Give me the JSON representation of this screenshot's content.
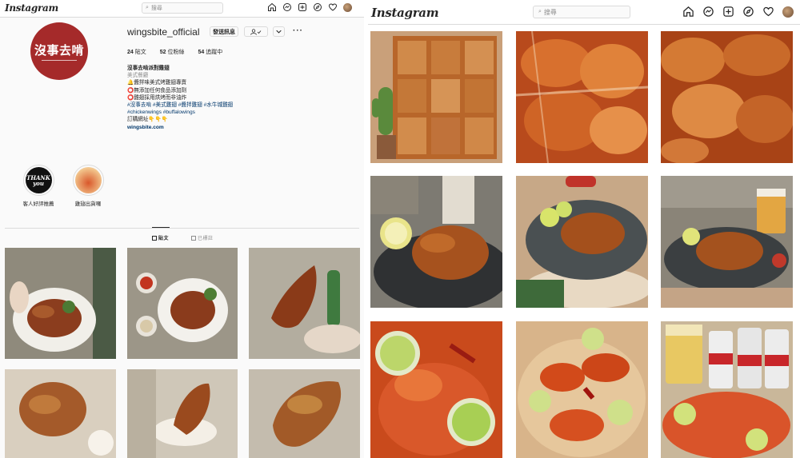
{
  "left": {
    "logo": "Instagram",
    "search_placeholder": "搜尋",
    "username": "wingsbite_official",
    "message_button": "發送訊息",
    "stats": {
      "posts_count": "24",
      "posts_label": "貼文",
      "followers_count": "52",
      "followers_label": "位粉絲",
      "following_count": "54",
      "following_label": "追蹤中"
    },
    "profile_pic_text": "沒事去啃",
    "bio": {
      "name": "沒事去啃派對雞翅",
      "category": "美式餐廳",
      "line1": "🔔醬拌味美式烤雞翅專賣",
      "line2": "⭕無添加任何食品添加劑",
      "line3": "⭕雞翅採用烘烤而非油炸",
      "tags_zh": "#沒事去啃 #美式雞翅 #醬拌雞翅 #水牛城雞翅",
      "tags_en": "#chickenwings #buffalowings",
      "order": "訂購網址👇👇👇",
      "link": "wingsbite.com"
    },
    "highlights": [
      {
        "label": "客人好評推薦",
        "cover_text": "THANK you"
      },
      {
        "label": "雞翅出貨囉",
        "cover_text": ""
      }
    ],
    "tabs": {
      "posts": "貼文",
      "tagged": "已標註"
    }
  },
  "right": {
    "logo": "Instagram",
    "search_placeholder": "搜尋"
  },
  "colors": {
    "accent_red": "#a52a2a",
    "border": "#dbdbdb",
    "muted": "#8e8e8e",
    "link": "#00376b"
  },
  "icons": [
    "home-icon",
    "messenger-icon",
    "new-post-icon",
    "explore-icon",
    "heart-icon"
  ]
}
